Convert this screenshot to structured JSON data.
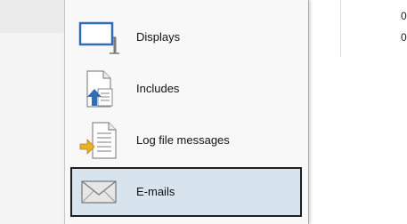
{
  "right_column": {
    "values": [
      "0",
      "0"
    ]
  },
  "menu": {
    "items": [
      {
        "label": "Displays",
        "icon": "monitor-icon"
      },
      {
        "label": "Includes",
        "icon": "include-document-icon"
      },
      {
        "label": "Log file messages",
        "icon": "log-file-icon"
      },
      {
        "label": "E-mails",
        "icon": "envelope-icon",
        "selected": true
      }
    ],
    "selection_bg": "#d7e4ee",
    "selection_border": "#1e1e1e"
  }
}
